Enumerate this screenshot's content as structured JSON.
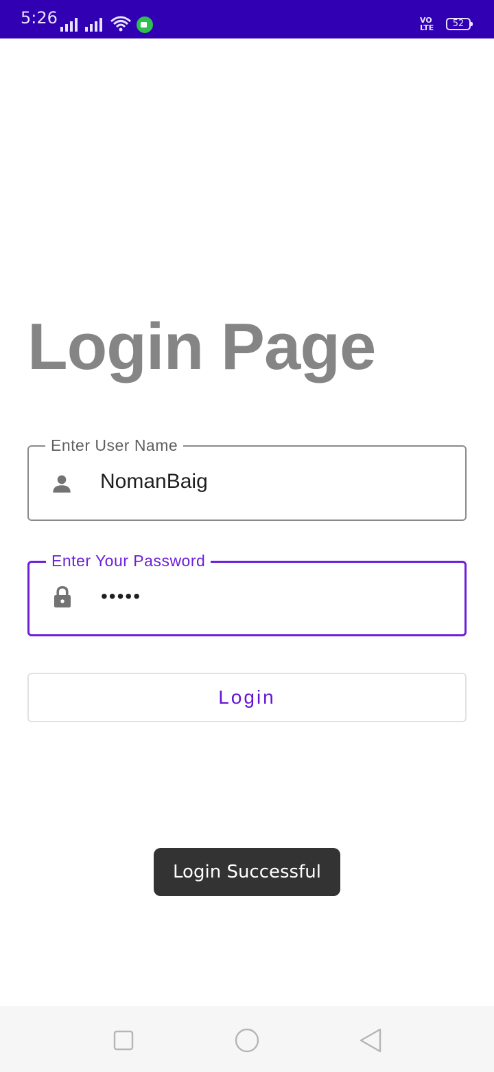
{
  "status_bar": {
    "time": "5:26",
    "volte": "VO LTE",
    "battery": "52",
    "color": "#3200b3"
  },
  "page": {
    "title": "Login Page"
  },
  "username_field": {
    "label": "Enter User Name",
    "value": "NomanBaig",
    "icon": "person-icon"
  },
  "password_field": {
    "label": "Enter Your Password",
    "value": "•••••",
    "icon": "lock-icon",
    "focus_color": "#6b1fdc"
  },
  "login_button": {
    "label": "Login",
    "color": "#6512d6"
  },
  "toast": {
    "message": "Login Successful"
  },
  "nav_bar": {
    "buttons": [
      "recents-icon",
      "home-icon",
      "back-icon"
    ]
  }
}
